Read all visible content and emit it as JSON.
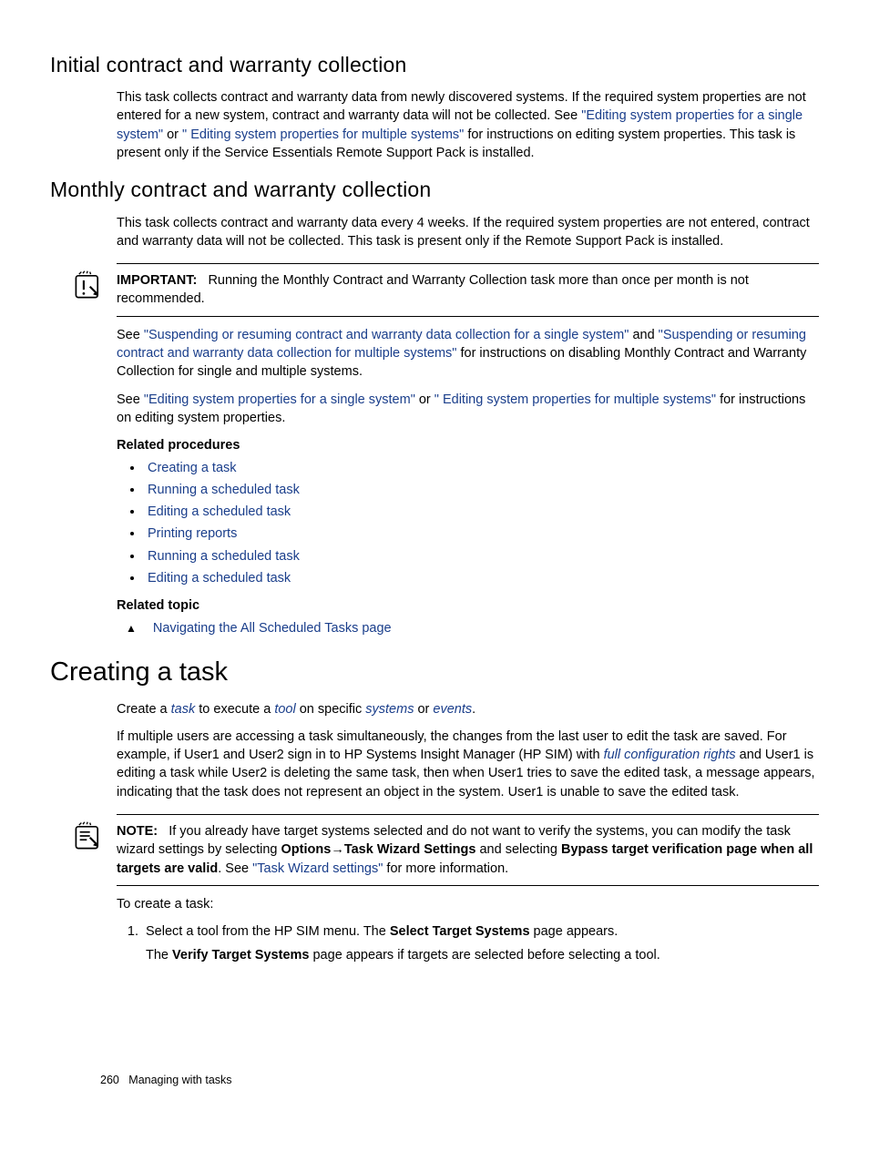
{
  "section1": {
    "title": "Initial contract and warranty collection",
    "p1a": "This task collects contract and warranty data from newly discovered systems. If the required system properties are not entered for a new system, contract and warranty data will not be collected. See ",
    "link1": "\"Editing system properties for a single system\"",
    "p1b": " or ",
    "link2": "\" Editing system properties for multiple systems\"",
    "p1c": " for instructions on editing system properties. This task is present only if the Service Essentials Remote Support Pack is installed."
  },
  "section2": {
    "title": "Monthly contract and warranty collection",
    "p1": "This task collects contract and warranty data every 4 weeks. If the required system properties are not entered, contract and warranty data will not be collected. This task is present only if the Remote Support Pack is installed."
  },
  "important": {
    "label": "IMPORTANT:",
    "text": "Running the Monthly Contract and Warranty Collection task more than once per month is not recommended."
  },
  "after_important": {
    "p1a": "See ",
    "link1": "\"Suspending or resuming contract and warranty data collection for a single system\"",
    "p1b": " and ",
    "link2": "\"Suspending or resuming contract and warranty data collection for multiple systems\"",
    "p1c": " for instructions on disabling Monthly Contract and Warranty Collection for single and multiple systems.",
    "p2a": "See ",
    "link3": "\"Editing system properties for a single system\"",
    "p2b": " or ",
    "link4": "\" Editing system properties for multiple systems\"",
    "p2c": " for instructions on editing system properties."
  },
  "related_procedures": {
    "heading": "Related procedures",
    "items": [
      "Creating a task",
      "Running a scheduled task",
      "Editing a scheduled task",
      "Printing reports",
      "Running a scheduled task",
      "Editing a scheduled task"
    ]
  },
  "related_topic": {
    "heading": "Related topic",
    "item": "Navigating the All Scheduled Tasks page"
  },
  "section3": {
    "title": "Creating a task",
    "p1a": "Create a ",
    "term_task": "task",
    "p1b": " to execute a ",
    "term_tool": "tool",
    "p1c": " on specific ",
    "term_systems": "systems",
    "p1d": " or ",
    "term_events": "events",
    "p1e": ".",
    "p2a": "If multiple users are accessing a task simultaneously, the changes from the last user to edit the task are saved. For example, if User1 and User2 sign in to HP Systems Insight Manager (HP SIM) with ",
    "term_rights": "full configuration rights",
    "p2b": " and User1 is editing a task while User2 is deleting the same task, then when User1 tries to save the edited task, a message appears, indicating that the task does not represent an object in the system. User1 is unable to save the edited task."
  },
  "note": {
    "label": "NOTE:",
    "t1": "If you already have target systems selected and do not want to verify the systems, you can modify the task wizard settings by selecting ",
    "b1": "Options",
    "arrow": "→",
    "b2": "Task Wizard Settings",
    "t2": " and selecting ",
    "b3": "Bypass target verification page when all targets are valid",
    "t3": ". See ",
    "link": "\"Task Wizard settings\"",
    "t4": " for more information."
  },
  "steps": {
    "intro": "To create a task:",
    "s1a": "Select a tool from the HP SIM menu. The ",
    "s1b": "Select Target Systems",
    "s1c": " page appears.",
    "s1d": "The ",
    "s1e": "Verify Target Systems",
    "s1f": " page appears if targets are selected before selecting a tool."
  },
  "footer": {
    "page": "260",
    "label": "Managing with tasks"
  }
}
